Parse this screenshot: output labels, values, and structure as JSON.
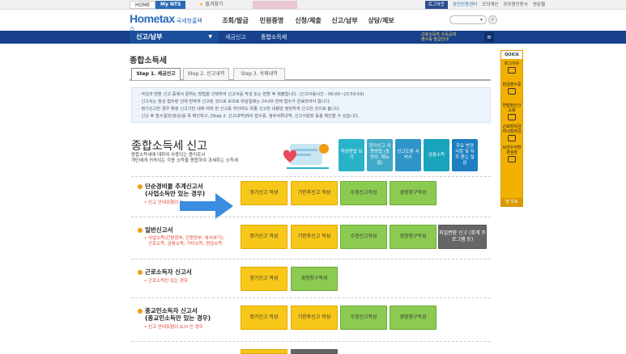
{
  "topbar": {
    "home": "HOME",
    "mynts": "My NTS",
    "favorites": "즐겨찾기",
    "user_name": "",
    "login": "로그아웃",
    "cert": "공인인증센터",
    "links": [
      "모의계산",
      "공무원인증서",
      "영문웹"
    ]
  },
  "header": {
    "logo_main": "Hometax",
    "logo_sub": "국세청홈택스",
    "gnb": [
      "조회/발급",
      "민원증명",
      "신청/제출",
      "신고/납부",
      "상담/제보"
    ]
  },
  "subnav": {
    "menu_title": "신고/납부",
    "crumbs": [
      "세금신고",
      "종합소득세"
    ],
    "notice_lines": [
      "근로소득자 소득공제",
      "영수증 발급안내"
    ]
  },
  "quick": {
    "head": "QUICK",
    "items": [
      "로그아웃",
      "현금영수증",
      "연말정산간소화",
      "근로장려금자녀장려금",
      "브라우저환경설정"
    ],
    "top": "맨 위로"
  },
  "page": {
    "title": "종합소득세",
    "tabs": [
      "Step 1. 세금신고",
      "Step 2. 신고내역",
      "Step 3. 삭제내역"
    ]
  },
  "guide": [
    "작성과 변환 신고 중에서 원하는 방법을 선택하여 신고서를 작성 또는 변환 후 제출합니다. (신고이용시간 : 06:00~23:59:59)",
    "신고서는 정상 접수된 건에 한하여 신고된 것으로 보므로 마감일에는 24:00 전에 접수가 완료되어야 합니다.",
    "정기신고한 경우 확정 신고기한 내에 여러 번 신고를 하더라도 최종 신고한 내용만 정당하게 신고한 것으로 봅니다.",
    "신고 후 접수결과(정상)를 꼭 확인하고, [Step 2. 신고내역]에서 접수증, 첨부서류내역, 신고서원장 등을 확인할 수 있습니다."
  ],
  "banner": {
    "title": "종합소득세 신고",
    "desc_line1": "종합소득세에 대하여 사용되는 용어로서",
    "desc_line2": "개인에게 귀속되는 각종 소득을 종합하여 과세하는 소득세",
    "buttons": [
      "작성방법 보기",
      "전자신고 이용방법 (동영상, 매뉴얼)",
      "신고도움 서비스",
      "금융소득",
      "주요 변경 사항 및 자주 묻는 질문"
    ]
  },
  "rows": [
    {
      "title_line1": "단순경비율 추계신고서",
      "title_line2": "(사업소득만 있는 경우)",
      "sub": "신고 안내유형이 F",
      "buttons": [
        "정기신고 작성",
        "기한후신고 작성",
        "수정신고작성",
        "경정청구작성"
      ]
    },
    {
      "title_line1": "일반신고서",
      "sub_line1": "사업소득(간편장부, 간편장부, 복식부기),",
      "sub_line2": "근로소득, 금융소득, 기타소득, 연금소득",
      "buttons": [
        "정기신고 작성",
        "기한후신고 작성",
        "수정신고작성",
        "경정청구작성",
        "파일변환 신고 (회계 프로그램 등)"
      ]
    },
    {
      "title_line1": "근로소득자 신고서",
      "sub": "근로소득만 있는 경우",
      "buttons": [
        "정기신고 작성",
        "경정청구작성"
      ]
    },
    {
      "title_line1": "종교인소득자 신고서",
      "title_line2": "(종교인소득만 있는 경우)",
      "sub": "신고 안내유형이 G,H 인 경우",
      "buttons": [
        "정기신고 작성",
        "기한후신고 작성",
        "수정신고작성",
        "경정청구작성"
      ]
    }
  ]
}
